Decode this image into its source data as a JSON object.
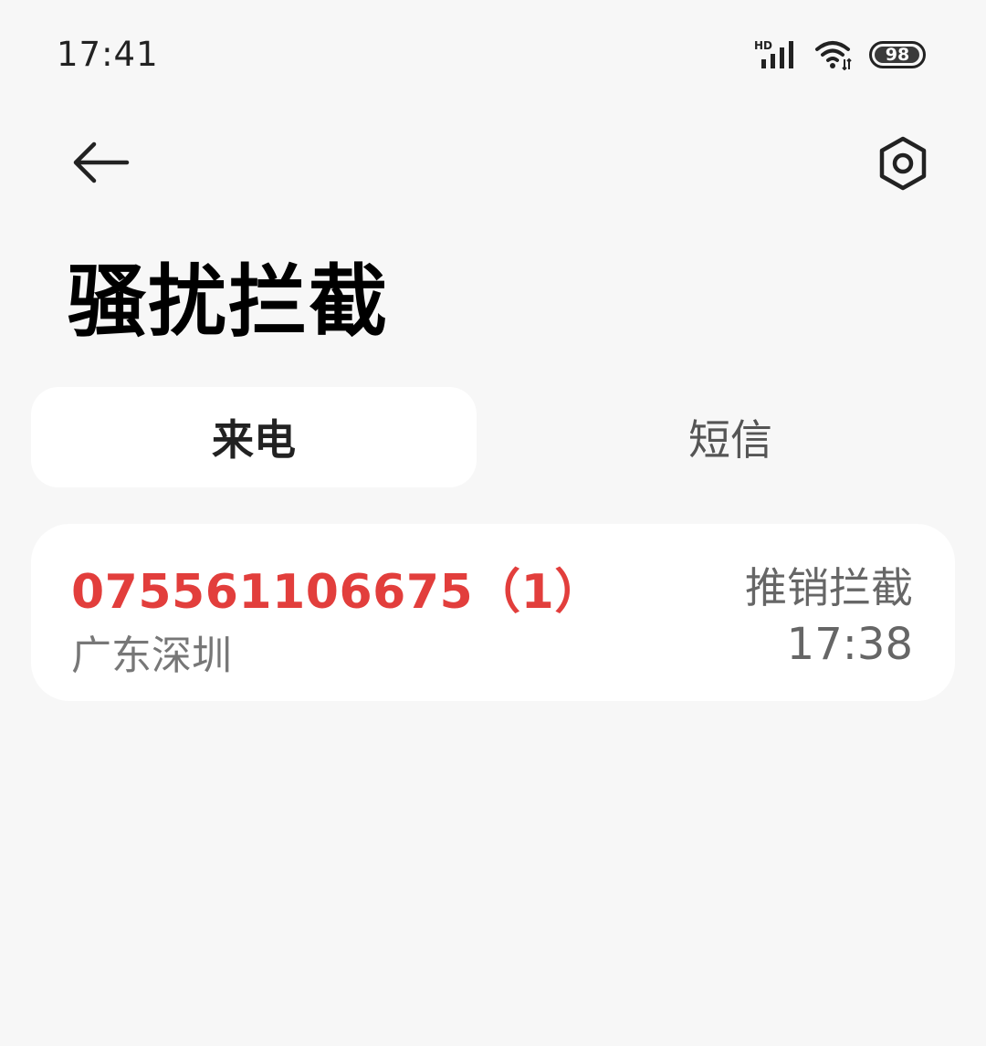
{
  "status_bar": {
    "time": "17:41",
    "signal_label": "HD",
    "battery_level": "98",
    "battery_percent": 98,
    "icons": [
      "hd-signal-icon",
      "wifi-icon",
      "battery-icon"
    ]
  },
  "app_bar": {
    "back_icon": "arrow-left-icon",
    "settings_icon": "hexagon-gear-icon"
  },
  "page": {
    "title": "骚扰拦截"
  },
  "tabs": [
    {
      "label": "来电",
      "active": true
    },
    {
      "label": "短信",
      "active": false
    }
  ],
  "calls": [
    {
      "number": "075561106675（1）",
      "location": "广东深圳",
      "tag": "推销拦截",
      "time": "17:38"
    }
  ],
  "colors": {
    "background": "#f7f7f7",
    "card": "#ffffff",
    "number_red": "#e23e3c",
    "secondary_text": "#777777"
  }
}
